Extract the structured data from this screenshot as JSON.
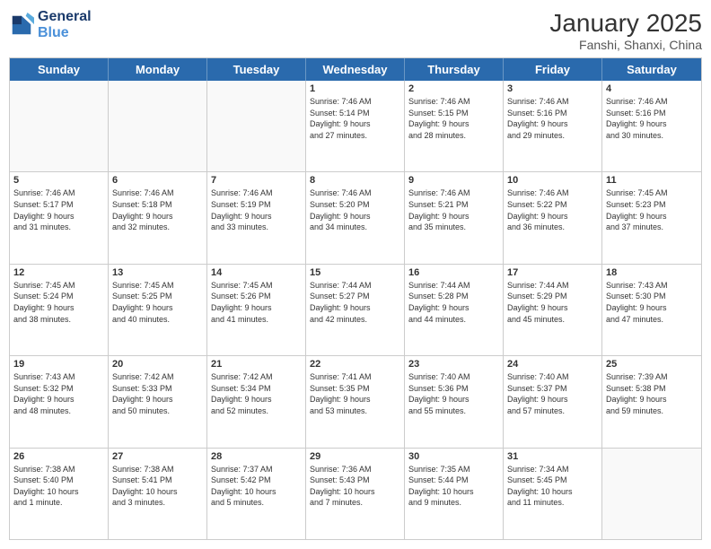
{
  "logo": {
    "line1": "General",
    "line2": "Blue"
  },
  "title": "January 2025",
  "location": "Fanshi, Shanxi, China",
  "dayHeaders": [
    "Sunday",
    "Monday",
    "Tuesday",
    "Wednesday",
    "Thursday",
    "Friday",
    "Saturday"
  ],
  "weeks": [
    [
      {
        "day": "",
        "text": ""
      },
      {
        "day": "",
        "text": ""
      },
      {
        "day": "",
        "text": ""
      },
      {
        "day": "1",
        "text": "Sunrise: 7:46 AM\nSunset: 5:14 PM\nDaylight: 9 hours\nand 27 minutes."
      },
      {
        "day": "2",
        "text": "Sunrise: 7:46 AM\nSunset: 5:15 PM\nDaylight: 9 hours\nand 28 minutes."
      },
      {
        "day": "3",
        "text": "Sunrise: 7:46 AM\nSunset: 5:16 PM\nDaylight: 9 hours\nand 29 minutes."
      },
      {
        "day": "4",
        "text": "Sunrise: 7:46 AM\nSunset: 5:16 PM\nDaylight: 9 hours\nand 30 minutes."
      }
    ],
    [
      {
        "day": "5",
        "text": "Sunrise: 7:46 AM\nSunset: 5:17 PM\nDaylight: 9 hours\nand 31 minutes."
      },
      {
        "day": "6",
        "text": "Sunrise: 7:46 AM\nSunset: 5:18 PM\nDaylight: 9 hours\nand 32 minutes."
      },
      {
        "day": "7",
        "text": "Sunrise: 7:46 AM\nSunset: 5:19 PM\nDaylight: 9 hours\nand 33 minutes."
      },
      {
        "day": "8",
        "text": "Sunrise: 7:46 AM\nSunset: 5:20 PM\nDaylight: 9 hours\nand 34 minutes."
      },
      {
        "day": "9",
        "text": "Sunrise: 7:46 AM\nSunset: 5:21 PM\nDaylight: 9 hours\nand 35 minutes."
      },
      {
        "day": "10",
        "text": "Sunrise: 7:46 AM\nSunset: 5:22 PM\nDaylight: 9 hours\nand 36 minutes."
      },
      {
        "day": "11",
        "text": "Sunrise: 7:45 AM\nSunset: 5:23 PM\nDaylight: 9 hours\nand 37 minutes."
      }
    ],
    [
      {
        "day": "12",
        "text": "Sunrise: 7:45 AM\nSunset: 5:24 PM\nDaylight: 9 hours\nand 38 minutes."
      },
      {
        "day": "13",
        "text": "Sunrise: 7:45 AM\nSunset: 5:25 PM\nDaylight: 9 hours\nand 40 minutes."
      },
      {
        "day": "14",
        "text": "Sunrise: 7:45 AM\nSunset: 5:26 PM\nDaylight: 9 hours\nand 41 minutes."
      },
      {
        "day": "15",
        "text": "Sunrise: 7:44 AM\nSunset: 5:27 PM\nDaylight: 9 hours\nand 42 minutes."
      },
      {
        "day": "16",
        "text": "Sunrise: 7:44 AM\nSunset: 5:28 PM\nDaylight: 9 hours\nand 44 minutes."
      },
      {
        "day": "17",
        "text": "Sunrise: 7:44 AM\nSunset: 5:29 PM\nDaylight: 9 hours\nand 45 minutes."
      },
      {
        "day": "18",
        "text": "Sunrise: 7:43 AM\nSunset: 5:30 PM\nDaylight: 9 hours\nand 47 minutes."
      }
    ],
    [
      {
        "day": "19",
        "text": "Sunrise: 7:43 AM\nSunset: 5:32 PM\nDaylight: 9 hours\nand 48 minutes."
      },
      {
        "day": "20",
        "text": "Sunrise: 7:42 AM\nSunset: 5:33 PM\nDaylight: 9 hours\nand 50 minutes."
      },
      {
        "day": "21",
        "text": "Sunrise: 7:42 AM\nSunset: 5:34 PM\nDaylight: 9 hours\nand 52 minutes."
      },
      {
        "day": "22",
        "text": "Sunrise: 7:41 AM\nSunset: 5:35 PM\nDaylight: 9 hours\nand 53 minutes."
      },
      {
        "day": "23",
        "text": "Sunrise: 7:40 AM\nSunset: 5:36 PM\nDaylight: 9 hours\nand 55 minutes."
      },
      {
        "day": "24",
        "text": "Sunrise: 7:40 AM\nSunset: 5:37 PM\nDaylight: 9 hours\nand 57 minutes."
      },
      {
        "day": "25",
        "text": "Sunrise: 7:39 AM\nSunset: 5:38 PM\nDaylight: 9 hours\nand 59 minutes."
      }
    ],
    [
      {
        "day": "26",
        "text": "Sunrise: 7:38 AM\nSunset: 5:40 PM\nDaylight: 10 hours\nand 1 minute."
      },
      {
        "day": "27",
        "text": "Sunrise: 7:38 AM\nSunset: 5:41 PM\nDaylight: 10 hours\nand 3 minutes."
      },
      {
        "day": "28",
        "text": "Sunrise: 7:37 AM\nSunset: 5:42 PM\nDaylight: 10 hours\nand 5 minutes."
      },
      {
        "day": "29",
        "text": "Sunrise: 7:36 AM\nSunset: 5:43 PM\nDaylight: 10 hours\nand 7 minutes."
      },
      {
        "day": "30",
        "text": "Sunrise: 7:35 AM\nSunset: 5:44 PM\nDaylight: 10 hours\nand 9 minutes."
      },
      {
        "day": "31",
        "text": "Sunrise: 7:34 AM\nSunset: 5:45 PM\nDaylight: 10 hours\nand 11 minutes."
      },
      {
        "day": "",
        "text": ""
      }
    ]
  ]
}
